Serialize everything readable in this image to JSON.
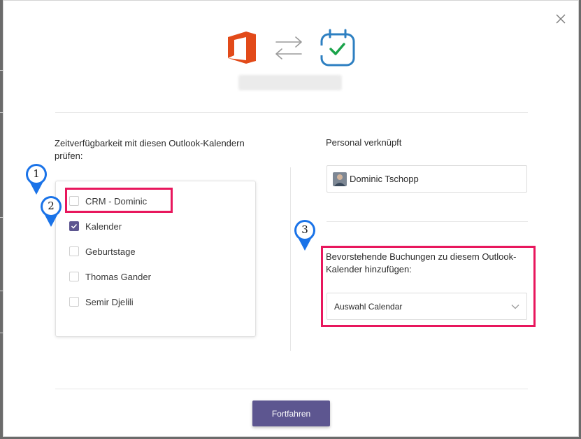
{
  "dialog": {
    "close_glyph": "✕",
    "icons": {
      "close": "close-icon",
      "office": "microsoft-office-logo-icon",
      "swap": "swap-arrows-icon",
      "calendar": "calendar-check-logo-icon"
    }
  },
  "left_panel": {
    "heading": "Zeitverfügbarkeit mit diesen Outlook-Kalendern prüfen:",
    "calendars": [
      {
        "label": "CRM - Dominic",
        "checked": false
      },
      {
        "label": "Kalender",
        "checked": true
      },
      {
        "label": "Geburtstage",
        "checked": false
      },
      {
        "label": "Thomas Gander",
        "checked": false
      },
      {
        "label": "Semir Djelili",
        "checked": false
      }
    ]
  },
  "right_panel": {
    "staff_heading": "Personal verknüpft",
    "staff_name": "Dominic Tschopp",
    "booking_heading": "Bevorstehende Buchungen zu diesem Outlook-Kalender hinzufügen:",
    "select_value": "Auswahl Calendar"
  },
  "footer": {
    "continue_label": "Fortfahren"
  },
  "annotations": {
    "markers": [
      "1",
      "2",
      "3"
    ],
    "marker_color": "#1a73e8",
    "highlight_color": "#e8175d"
  },
  "colors": {
    "accent": "#5d5690",
    "office_logo": "#e24a19",
    "calendar_logo": "#2d7fc1",
    "check_green": "#1aa34a"
  }
}
